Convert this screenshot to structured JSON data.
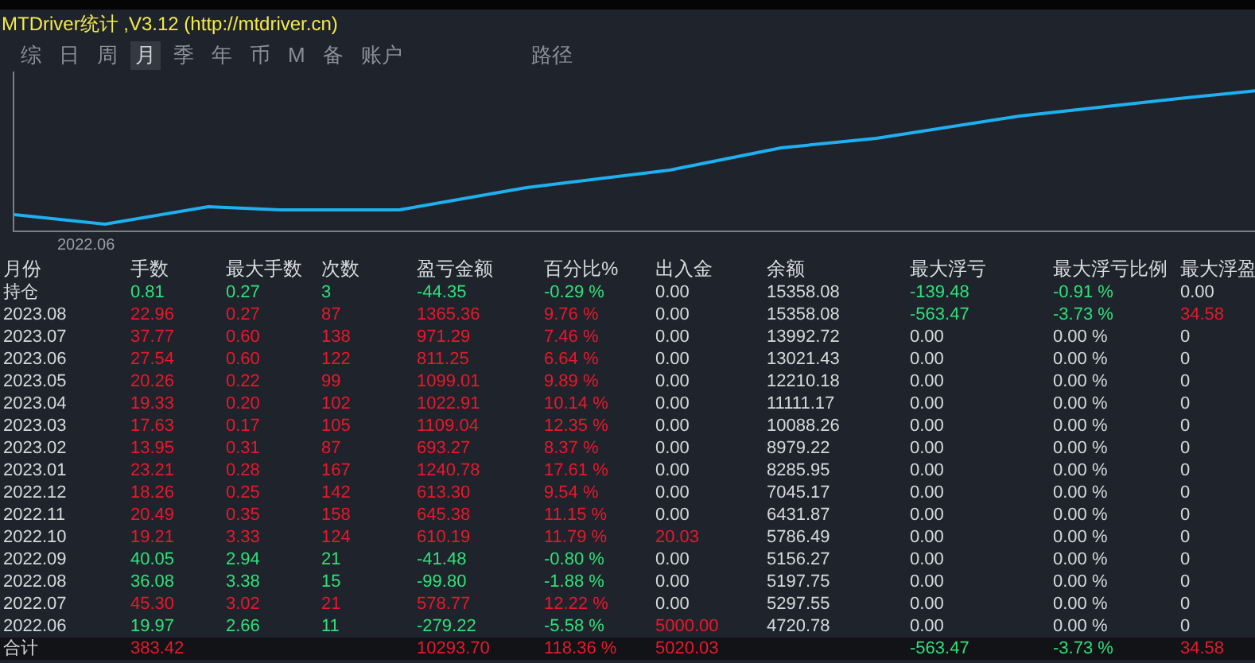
{
  "window": {
    "title": "MTDriver统计 ,V3.12 (http://mtdriver.cn)"
  },
  "tabs": [
    {
      "label": "综",
      "selected": false
    },
    {
      "label": "日",
      "selected": false
    },
    {
      "label": "周",
      "selected": false
    },
    {
      "label": "月",
      "selected": true
    },
    {
      "label": "季",
      "selected": false
    },
    {
      "label": "年",
      "selected": false
    },
    {
      "label": "币",
      "selected": false
    },
    {
      "label": "M",
      "selected": false
    },
    {
      "label": "备",
      "selected": false
    },
    {
      "label": "账户",
      "selected": false
    },
    {
      "label": "路径",
      "selected": false
    }
  ],
  "chart": {
    "x_label": "2022.06"
  },
  "table": {
    "columns": [
      "月份",
      "手数",
      "最大手数",
      "次数",
      "盈亏金额",
      "百分比%",
      "出入金",
      "余额",
      "最大浮亏",
      "最大浮亏比例",
      "最大浮盈"
    ],
    "rows": [
      {
        "cells": [
          {
            "text": "持仓",
            "color": "#d6d8dc"
          },
          {
            "text": "0.81",
            "color": "#2ee07a"
          },
          {
            "text": "0.27",
            "color": "#2ee07a"
          },
          {
            "text": "3",
            "color": "#2ee07a"
          },
          {
            "text": "-44.35",
            "color": "#2ee07a"
          },
          {
            "text": "-0.29 %",
            "color": "#2ee07a"
          },
          {
            "text": "0.00",
            "color": "#d6d8dc"
          },
          {
            "text": "15358.08",
            "color": "#d6d8dc"
          },
          {
            "text": "-139.48",
            "color": "#2ee07a"
          },
          {
            "text": "-0.91 %",
            "color": "#2ee07a"
          },
          {
            "text": "0.00",
            "color": "#d6d8dc"
          }
        ]
      },
      {
        "cells": [
          {
            "text": "2023.08",
            "color": "#d6d8dc"
          },
          {
            "text": "22.96",
            "color": "#e8192c"
          },
          {
            "text": "0.27",
            "color": "#e8192c"
          },
          {
            "text": "87",
            "color": "#e8192c"
          },
          {
            "text": "1365.36",
            "color": "#e8192c"
          },
          {
            "text": "9.76 %",
            "color": "#e8192c"
          },
          {
            "text": "0.00",
            "color": "#d6d8dc"
          },
          {
            "text": "15358.08",
            "color": "#d6d8dc"
          },
          {
            "text": "-563.47",
            "color": "#2ee07a"
          },
          {
            "text": "-3.73 %",
            "color": "#2ee07a"
          },
          {
            "text": "34.58",
            "color": "#e8192c"
          }
        ]
      },
      {
        "cells": [
          {
            "text": "2023.07",
            "color": "#d6d8dc"
          },
          {
            "text": "37.77",
            "color": "#e8192c"
          },
          {
            "text": "0.60",
            "color": "#e8192c"
          },
          {
            "text": "138",
            "color": "#e8192c"
          },
          {
            "text": "971.29",
            "color": "#e8192c"
          },
          {
            "text": "7.46 %",
            "color": "#e8192c"
          },
          {
            "text": "0.00",
            "color": "#d6d8dc"
          },
          {
            "text": "13992.72",
            "color": "#d6d8dc"
          },
          {
            "text": "0.00",
            "color": "#d6d8dc"
          },
          {
            "text": "0.00 %",
            "color": "#d6d8dc"
          },
          {
            "text": "0",
            "color": "#d6d8dc"
          }
        ]
      },
      {
        "cells": [
          {
            "text": "2023.06",
            "color": "#d6d8dc"
          },
          {
            "text": "27.54",
            "color": "#e8192c"
          },
          {
            "text": "0.60",
            "color": "#e8192c"
          },
          {
            "text": "122",
            "color": "#e8192c"
          },
          {
            "text": "811.25",
            "color": "#e8192c"
          },
          {
            "text": "6.64 %",
            "color": "#e8192c"
          },
          {
            "text": "0.00",
            "color": "#d6d8dc"
          },
          {
            "text": "13021.43",
            "color": "#d6d8dc"
          },
          {
            "text": "0.00",
            "color": "#d6d8dc"
          },
          {
            "text": "0.00 %",
            "color": "#d6d8dc"
          },
          {
            "text": "0",
            "color": "#d6d8dc"
          }
        ]
      },
      {
        "cells": [
          {
            "text": "2023.05",
            "color": "#d6d8dc"
          },
          {
            "text": "20.26",
            "color": "#e8192c"
          },
          {
            "text": "0.22",
            "color": "#e8192c"
          },
          {
            "text": "99",
            "color": "#e8192c"
          },
          {
            "text": "1099.01",
            "color": "#e8192c"
          },
          {
            "text": "9.89 %",
            "color": "#e8192c"
          },
          {
            "text": "0.00",
            "color": "#d6d8dc"
          },
          {
            "text": "12210.18",
            "color": "#d6d8dc"
          },
          {
            "text": "0.00",
            "color": "#d6d8dc"
          },
          {
            "text": "0.00 %",
            "color": "#d6d8dc"
          },
          {
            "text": "0",
            "color": "#d6d8dc"
          }
        ]
      },
      {
        "cells": [
          {
            "text": "2023.04",
            "color": "#d6d8dc"
          },
          {
            "text": "19.33",
            "color": "#e8192c"
          },
          {
            "text": "0.20",
            "color": "#e8192c"
          },
          {
            "text": "102",
            "color": "#e8192c"
          },
          {
            "text": "1022.91",
            "color": "#e8192c"
          },
          {
            "text": "10.14 %",
            "color": "#e8192c"
          },
          {
            "text": "0.00",
            "color": "#d6d8dc"
          },
          {
            "text": "11111.17",
            "color": "#d6d8dc"
          },
          {
            "text": "0.00",
            "color": "#d6d8dc"
          },
          {
            "text": "0.00 %",
            "color": "#d6d8dc"
          },
          {
            "text": "0",
            "color": "#d6d8dc"
          }
        ]
      },
      {
        "cells": [
          {
            "text": "2023.03",
            "color": "#d6d8dc"
          },
          {
            "text": "17.63",
            "color": "#e8192c"
          },
          {
            "text": "0.17",
            "color": "#e8192c"
          },
          {
            "text": "105",
            "color": "#e8192c"
          },
          {
            "text": "1109.04",
            "color": "#e8192c"
          },
          {
            "text": "12.35 %",
            "color": "#e8192c"
          },
          {
            "text": "0.00",
            "color": "#d6d8dc"
          },
          {
            "text": "10088.26",
            "color": "#d6d8dc"
          },
          {
            "text": "0.00",
            "color": "#d6d8dc"
          },
          {
            "text": "0.00 %",
            "color": "#d6d8dc"
          },
          {
            "text": "0",
            "color": "#d6d8dc"
          }
        ]
      },
      {
        "cells": [
          {
            "text": "2023.02",
            "color": "#d6d8dc"
          },
          {
            "text": "13.95",
            "color": "#e8192c"
          },
          {
            "text": "0.31",
            "color": "#e8192c"
          },
          {
            "text": "87",
            "color": "#e8192c"
          },
          {
            "text": "693.27",
            "color": "#e8192c"
          },
          {
            "text": "8.37 %",
            "color": "#e8192c"
          },
          {
            "text": "0.00",
            "color": "#d6d8dc"
          },
          {
            "text": "8979.22",
            "color": "#d6d8dc"
          },
          {
            "text": "0.00",
            "color": "#d6d8dc"
          },
          {
            "text": "0.00 %",
            "color": "#d6d8dc"
          },
          {
            "text": "0",
            "color": "#d6d8dc"
          }
        ]
      },
      {
        "cells": [
          {
            "text": "2023.01",
            "color": "#d6d8dc"
          },
          {
            "text": "23.21",
            "color": "#e8192c"
          },
          {
            "text": "0.28",
            "color": "#e8192c"
          },
          {
            "text": "167",
            "color": "#e8192c"
          },
          {
            "text": "1240.78",
            "color": "#e8192c"
          },
          {
            "text": "17.61 %",
            "color": "#e8192c"
          },
          {
            "text": "0.00",
            "color": "#d6d8dc"
          },
          {
            "text": "8285.95",
            "color": "#d6d8dc"
          },
          {
            "text": "0.00",
            "color": "#d6d8dc"
          },
          {
            "text": "0.00 %",
            "color": "#d6d8dc"
          },
          {
            "text": "0",
            "color": "#d6d8dc"
          }
        ]
      },
      {
        "cells": [
          {
            "text": "2022.12",
            "color": "#d6d8dc"
          },
          {
            "text": "18.26",
            "color": "#e8192c"
          },
          {
            "text": "0.25",
            "color": "#e8192c"
          },
          {
            "text": "142",
            "color": "#e8192c"
          },
          {
            "text": "613.30",
            "color": "#e8192c"
          },
          {
            "text": "9.54 %",
            "color": "#e8192c"
          },
          {
            "text": "0.00",
            "color": "#d6d8dc"
          },
          {
            "text": "7045.17",
            "color": "#d6d8dc"
          },
          {
            "text": "0.00",
            "color": "#d6d8dc"
          },
          {
            "text": "0.00 %",
            "color": "#d6d8dc"
          },
          {
            "text": "0",
            "color": "#d6d8dc"
          }
        ]
      },
      {
        "cells": [
          {
            "text": "2022.11",
            "color": "#d6d8dc"
          },
          {
            "text": "20.49",
            "color": "#e8192c"
          },
          {
            "text": "0.35",
            "color": "#e8192c"
          },
          {
            "text": "158",
            "color": "#e8192c"
          },
          {
            "text": "645.38",
            "color": "#e8192c"
          },
          {
            "text": "11.15 %",
            "color": "#e8192c"
          },
          {
            "text": "0.00",
            "color": "#d6d8dc"
          },
          {
            "text": "6431.87",
            "color": "#d6d8dc"
          },
          {
            "text": "0.00",
            "color": "#d6d8dc"
          },
          {
            "text": "0.00 %",
            "color": "#d6d8dc"
          },
          {
            "text": "0",
            "color": "#d6d8dc"
          }
        ]
      },
      {
        "cells": [
          {
            "text": "2022.10",
            "color": "#d6d8dc"
          },
          {
            "text": "19.21",
            "color": "#e8192c"
          },
          {
            "text": "3.33",
            "color": "#e8192c"
          },
          {
            "text": "124",
            "color": "#e8192c"
          },
          {
            "text": "610.19",
            "color": "#e8192c"
          },
          {
            "text": "11.79 %",
            "color": "#e8192c"
          },
          {
            "text": "20.03",
            "color": "#e8192c"
          },
          {
            "text": "5786.49",
            "color": "#d6d8dc"
          },
          {
            "text": "0.00",
            "color": "#d6d8dc"
          },
          {
            "text": "0.00 %",
            "color": "#d6d8dc"
          },
          {
            "text": "0",
            "color": "#d6d8dc"
          }
        ]
      },
      {
        "cells": [
          {
            "text": "2022.09",
            "color": "#d6d8dc"
          },
          {
            "text": "40.05",
            "color": "#2ee07a"
          },
          {
            "text": "2.94",
            "color": "#2ee07a"
          },
          {
            "text": "21",
            "color": "#2ee07a"
          },
          {
            "text": "-41.48",
            "color": "#2ee07a"
          },
          {
            "text": "-0.80 %",
            "color": "#2ee07a"
          },
          {
            "text": "0.00",
            "color": "#d6d8dc"
          },
          {
            "text": "5156.27",
            "color": "#d6d8dc"
          },
          {
            "text": "0.00",
            "color": "#d6d8dc"
          },
          {
            "text": "0.00 %",
            "color": "#d6d8dc"
          },
          {
            "text": "0",
            "color": "#d6d8dc"
          }
        ]
      },
      {
        "cells": [
          {
            "text": "2022.08",
            "color": "#d6d8dc"
          },
          {
            "text": "36.08",
            "color": "#2ee07a"
          },
          {
            "text": "3.38",
            "color": "#2ee07a"
          },
          {
            "text": "15",
            "color": "#2ee07a"
          },
          {
            "text": "-99.80",
            "color": "#2ee07a"
          },
          {
            "text": "-1.88 %",
            "color": "#2ee07a"
          },
          {
            "text": "0.00",
            "color": "#d6d8dc"
          },
          {
            "text": "5197.75",
            "color": "#d6d8dc"
          },
          {
            "text": "0.00",
            "color": "#d6d8dc"
          },
          {
            "text": "0.00 %",
            "color": "#d6d8dc"
          },
          {
            "text": "0",
            "color": "#d6d8dc"
          }
        ]
      },
      {
        "cells": [
          {
            "text": "2022.07",
            "color": "#d6d8dc"
          },
          {
            "text": "45.30",
            "color": "#e8192c"
          },
          {
            "text": "3.02",
            "color": "#e8192c"
          },
          {
            "text": "21",
            "color": "#e8192c"
          },
          {
            "text": "578.77",
            "color": "#e8192c"
          },
          {
            "text": "12.22 %",
            "color": "#e8192c"
          },
          {
            "text": "0.00",
            "color": "#d6d8dc"
          },
          {
            "text": "5297.55",
            "color": "#d6d8dc"
          },
          {
            "text": "0.00",
            "color": "#d6d8dc"
          },
          {
            "text": "0.00 %",
            "color": "#d6d8dc"
          },
          {
            "text": "0",
            "color": "#d6d8dc"
          }
        ]
      },
      {
        "cells": [
          {
            "text": "2022.06",
            "color": "#d6d8dc"
          },
          {
            "text": "19.97",
            "color": "#2ee07a"
          },
          {
            "text": "2.66",
            "color": "#2ee07a"
          },
          {
            "text": "11",
            "color": "#2ee07a"
          },
          {
            "text": "-279.22",
            "color": "#2ee07a"
          },
          {
            "text": "-5.58 %",
            "color": "#2ee07a"
          },
          {
            "text": "5000.00",
            "color": "#e8192c"
          },
          {
            "text": "4720.78",
            "color": "#d6d8dc"
          },
          {
            "text": "0.00",
            "color": "#d6d8dc"
          },
          {
            "text": "0.00 %",
            "color": "#d6d8dc"
          },
          {
            "text": "0",
            "color": "#d6d8dc"
          }
        ]
      }
    ],
    "total": {
      "cells": [
        {
          "text": "合计",
          "color": "#d6d8dc"
        },
        {
          "text": "383.42",
          "color": "#e8192c"
        },
        null,
        null,
        {
          "text": "10293.70",
          "color": "#e8192c"
        },
        {
          "text": "118.36 %",
          "color": "#e8192c"
        },
        {
          "text": "5020.03",
          "color": "#e8192c"
        },
        null,
        {
          "text": "-563.47",
          "color": "#2ee07a"
        },
        {
          "text": "-3.73 %",
          "color": "#2ee07a"
        },
        {
          "text": "34.58",
          "color": "#e8192c"
        }
      ]
    }
  }
}
